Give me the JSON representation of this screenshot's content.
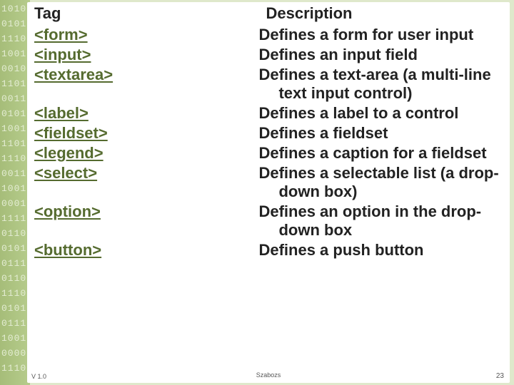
{
  "binary_lines": [
    "1010",
    "0101",
    "1110",
    "1001",
    "0010",
    "1101",
    "0011",
    "0101",
    "1001",
    "1101",
    "1110",
    "0011",
    "1001",
    "0001",
    "1111",
    "0110",
    "0101",
    "0111",
    "0110",
    "1110",
    "0101",
    "0111",
    "1001",
    "0000",
    "1110"
  ],
  "headers": {
    "tag": "Tag",
    "desc": "Description"
  },
  "rows": [
    {
      "tag": "<form>",
      "desc": "Defines a form for user input"
    },
    {
      "tag": "<input>",
      "desc": "Defines an input field"
    },
    {
      "tag": "<textarea>",
      "desc": "Defines a text-area (a multi-line text input control)"
    },
    {
      "tag": "<label>",
      "desc": "Defines a label to a control"
    },
    {
      "tag": "<fieldset>",
      "desc": "Defines a fieldset"
    },
    {
      "tag": "<legend>",
      "desc": "Defines a caption for a fieldset"
    },
    {
      "tag": "<select>",
      "desc": "Defines a selectable list (a drop-down box)"
    },
    {
      "tag": "<option>",
      "desc": "Defines an option in the drop-down box"
    },
    {
      "tag": "<button>",
      "desc": "Defines a push button"
    }
  ],
  "footer": {
    "left": "V 1.0",
    "center": "Szabozs",
    "right": "23"
  }
}
